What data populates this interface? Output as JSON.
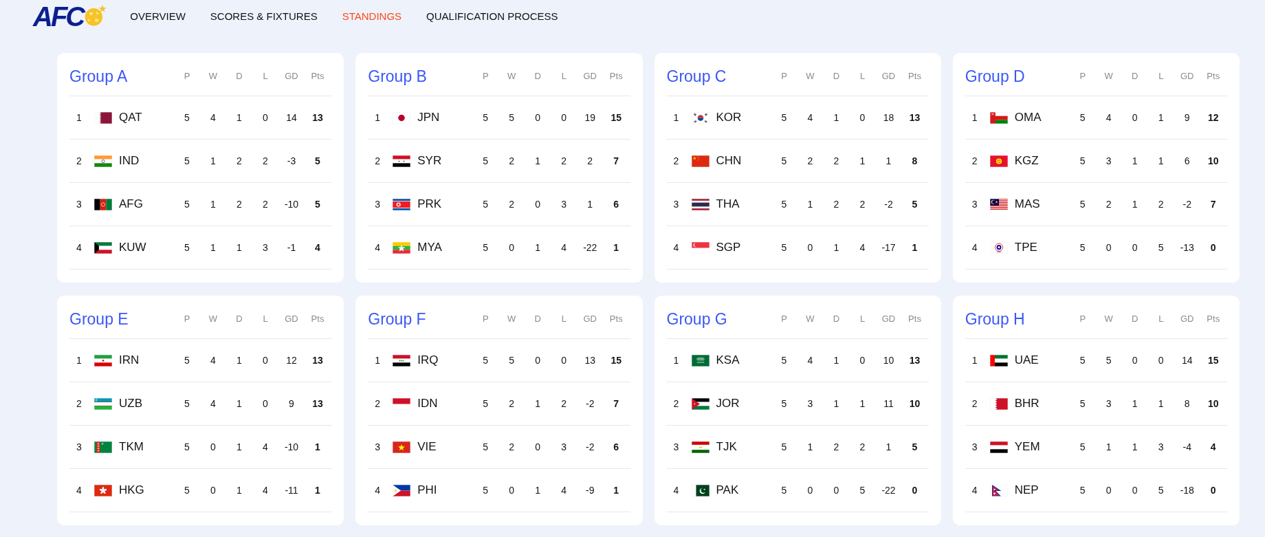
{
  "logo": {
    "text": "AFC"
  },
  "nav": [
    {
      "label": "OVERVIEW",
      "selected": false
    },
    {
      "label": "SCORES & FIXTURES",
      "selected": false
    },
    {
      "label": "STANDINGS",
      "selected": true
    },
    {
      "label": "QUALIFICATION PROCESS",
      "selected": false
    }
  ],
  "groups": [
    {
      "title": "Group A",
      "columns": [
        "P",
        "W",
        "D",
        "L",
        "GD",
        "Pts"
      ],
      "rows": [
        {
          "rank": "1",
          "team": "QAT",
          "p": "5",
          "w": "4",
          "d": "1",
          "l": "0",
          "gd": "14",
          "pts": "13"
        },
        {
          "rank": "2",
          "team": "IND",
          "p": "5",
          "w": "1",
          "d": "2",
          "l": "2",
          "gd": "-3",
          "pts": "5"
        },
        {
          "rank": "3",
          "team": "AFG",
          "p": "5",
          "w": "1",
          "d": "2",
          "l": "2",
          "gd": "-10",
          "pts": "5"
        },
        {
          "rank": "4",
          "team": "KUW",
          "p": "5",
          "w": "1",
          "d": "1",
          "l": "3",
          "gd": "-1",
          "pts": "4"
        }
      ]
    },
    {
      "title": "Group B",
      "columns": [
        "P",
        "W",
        "D",
        "L",
        "GD",
        "Pts"
      ],
      "rows": [
        {
          "rank": "1",
          "team": "JPN",
          "p": "5",
          "w": "5",
          "d": "0",
          "l": "0",
          "gd": "19",
          "pts": "15"
        },
        {
          "rank": "2",
          "team": "SYR",
          "p": "5",
          "w": "2",
          "d": "1",
          "l": "2",
          "gd": "2",
          "pts": "7"
        },
        {
          "rank": "3",
          "team": "PRK",
          "p": "5",
          "w": "2",
          "d": "0",
          "l": "3",
          "gd": "1",
          "pts": "6"
        },
        {
          "rank": "4",
          "team": "MYA",
          "p": "5",
          "w": "0",
          "d": "1",
          "l": "4",
          "gd": "-22",
          "pts": "1"
        }
      ]
    },
    {
      "title": "Group C",
      "columns": [
        "P",
        "W",
        "D",
        "L",
        "GD",
        "Pts"
      ],
      "rows": [
        {
          "rank": "1",
          "team": "KOR",
          "p": "5",
          "w": "4",
          "d": "1",
          "l": "0",
          "gd": "18",
          "pts": "13"
        },
        {
          "rank": "2",
          "team": "CHN",
          "p": "5",
          "w": "2",
          "d": "2",
          "l": "1",
          "gd": "1",
          "pts": "8"
        },
        {
          "rank": "3",
          "team": "THA",
          "p": "5",
          "w": "1",
          "d": "2",
          "l": "2",
          "gd": "-2",
          "pts": "5"
        },
        {
          "rank": "4",
          "team": "SGP",
          "p": "5",
          "w": "0",
          "d": "1",
          "l": "4",
          "gd": "-17",
          "pts": "1"
        }
      ]
    },
    {
      "title": "Group D",
      "columns": [
        "P",
        "W",
        "D",
        "L",
        "GD",
        "Pts"
      ],
      "rows": [
        {
          "rank": "1",
          "team": "OMA",
          "p": "5",
          "w": "4",
          "d": "0",
          "l": "1",
          "gd": "9",
          "pts": "12"
        },
        {
          "rank": "2",
          "team": "KGZ",
          "p": "5",
          "w": "3",
          "d": "1",
          "l": "1",
          "gd": "6",
          "pts": "10"
        },
        {
          "rank": "3",
          "team": "MAS",
          "p": "5",
          "w": "2",
          "d": "1",
          "l": "2",
          "gd": "-2",
          "pts": "7"
        },
        {
          "rank": "4",
          "team": "TPE",
          "p": "5",
          "w": "0",
          "d": "0",
          "l": "5",
          "gd": "-13",
          "pts": "0"
        }
      ]
    },
    {
      "title": "Group E",
      "columns": [
        "P",
        "W",
        "D",
        "L",
        "GD",
        "Pts"
      ],
      "rows": [
        {
          "rank": "1",
          "team": "IRN",
          "p": "5",
          "w": "4",
          "d": "1",
          "l": "0",
          "gd": "12",
          "pts": "13"
        },
        {
          "rank": "2",
          "team": "UZB",
          "p": "5",
          "w": "4",
          "d": "1",
          "l": "0",
          "gd": "9",
          "pts": "13"
        },
        {
          "rank": "3",
          "team": "TKM",
          "p": "5",
          "w": "0",
          "d": "1",
          "l": "4",
          "gd": "-10",
          "pts": "1"
        },
        {
          "rank": "4",
          "team": "HKG",
          "p": "5",
          "w": "0",
          "d": "1",
          "l": "4",
          "gd": "-11",
          "pts": "1"
        }
      ]
    },
    {
      "title": "Group F",
      "columns": [
        "P",
        "W",
        "D",
        "L",
        "GD",
        "Pts"
      ],
      "rows": [
        {
          "rank": "1",
          "team": "IRQ",
          "p": "5",
          "w": "5",
          "d": "0",
          "l": "0",
          "gd": "13",
          "pts": "15"
        },
        {
          "rank": "2",
          "team": "IDN",
          "p": "5",
          "w": "2",
          "d": "1",
          "l": "2",
          "gd": "-2",
          "pts": "7"
        },
        {
          "rank": "3",
          "team": "VIE",
          "p": "5",
          "w": "2",
          "d": "0",
          "l": "3",
          "gd": "-2",
          "pts": "6"
        },
        {
          "rank": "4",
          "team": "PHI",
          "p": "5",
          "w": "0",
          "d": "1",
          "l": "4",
          "gd": "-9",
          "pts": "1"
        }
      ]
    },
    {
      "title": "Group G",
      "columns": [
        "P",
        "W",
        "D",
        "L",
        "GD",
        "Pts"
      ],
      "rows": [
        {
          "rank": "1",
          "team": "KSA",
          "p": "5",
          "w": "4",
          "d": "1",
          "l": "0",
          "gd": "10",
          "pts": "13"
        },
        {
          "rank": "2",
          "team": "JOR",
          "p": "5",
          "w": "3",
          "d": "1",
          "l": "1",
          "gd": "11",
          "pts": "10"
        },
        {
          "rank": "3",
          "team": "TJK",
          "p": "5",
          "w": "1",
          "d": "2",
          "l": "2",
          "gd": "1",
          "pts": "5"
        },
        {
          "rank": "4",
          "team": "PAK",
          "p": "5",
          "w": "0",
          "d": "0",
          "l": "5",
          "gd": "-22",
          "pts": "0"
        }
      ]
    },
    {
      "title": "Group H",
      "columns": [
        "P",
        "W",
        "D",
        "L",
        "GD",
        "Pts"
      ],
      "rows": [
        {
          "rank": "1",
          "team": "UAE",
          "p": "5",
          "w": "5",
          "d": "0",
          "l": "0",
          "gd": "14",
          "pts": "15"
        },
        {
          "rank": "2",
          "team": "BHR",
          "p": "5",
          "w": "3",
          "d": "1",
          "l": "1",
          "gd": "8",
          "pts": "10"
        },
        {
          "rank": "3",
          "team": "YEM",
          "p": "5",
          "w": "1",
          "d": "1",
          "l": "3",
          "gd": "-4",
          "pts": "4"
        },
        {
          "rank": "4",
          "team": "NEP",
          "p": "5",
          "w": "0",
          "d": "0",
          "l": "5",
          "gd": "-18",
          "pts": "0"
        }
      ]
    }
  ]
}
